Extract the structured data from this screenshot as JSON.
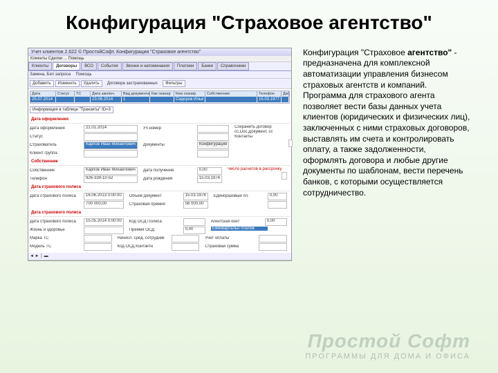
{
  "title": "Конфигурация \"Страховое агентство\"",
  "desc": {
    "a": "Конфигурация \"Страховое ",
    "b": "агентство\"",
    "c": " - предназначена для комплексной автоматизации управления бизнесом страховых агентств и компаний. Программа для страхового агента позволяет вести базы данных учета клиентов (юридических и физических лиц), заключенных с ними страховых договоров, выставлять им счета и контролировать оплату, а также задолженности, оформлять договора и любые другие документы по шаблонам, вести перечень банков, с которыми осуществляется сотрудничество."
  },
  "logo": {
    "t": "Простой Софт",
    "s": "ПРОГРАММЫ ДЛЯ ДОМА И ОФИСА"
  },
  "win": {
    "title": "Учет клиентов 2.622 © ПростойСофт. Конфигурация \"Страховое агентство\"",
    "menu": "Клиенты Сделки ... Помощь"
  },
  "tabs": [
    "Клиенты",
    "Договоры",
    "ВСО",
    "События",
    "Звонки и напоминания",
    "Платежи",
    "Банки",
    "Справочники"
  ],
  "tbar": {
    "b1": "Добавить",
    "b2": "Изменить",
    "b3": "Удалить",
    "mid": "Договора застрахованных",
    "f": "Фильтры"
  },
  "lvl2": {
    "l1": "Замена, Бял запроса",
    "l2": "Помощь"
  },
  "gridH": [
    "Дата",
    "Статус",
    "ТС",
    "Дата заключ.",
    "Вид документа",
    "Как сканер",
    "Кем сканир.",
    "Собственник",
    "Телефон",
    "Дата начала"
  ],
  "gridR": [
    "25.07.2014",
    "",
    "",
    "23.06.2014",
    "1",
    "",
    "Сидоров Илья Михайлович",
    "",
    "15.03.1977"
  ],
  "panel": "Информация в таблице \"Транзиты\" ID=3",
  "form": {
    "h1": "Дата оформления",
    "v1": "21.01.2014",
    "n1": "Уч номер",
    "h2": "Статус",
    "h3": "Страхователь",
    "v3": "Карпов Иван Михайлович",
    "n3": "Документы",
    "nv3": "Конфигурация",
    "h4": "Клиент группа",
    "h5": "Собственник",
    "h6": "Карпов Иван Михайлович",
    "h7": "Телефон",
    "v7": "926-339-10-52",
    "n7": "Дата рождения",
    "nv7": "15.03.1974",
    "h8": "Дата страхового полиса",
    "v8": "16.06.2013 0:00:00",
    "n8": "Дата получения",
    "nv8": "0,00",
    "r8": "Число расчетов в рассрочку",
    "v9": "700 000,00",
    "n9": "Объем документ",
    "nv9": "15.03.1974",
    "n10": "Страховая премия",
    "nv10": "56 000,00",
    "r10": "Единоразовый пл.",
    "rv10": "0,00",
    "ha": "Дата страхового полиса",
    "va": "15.05.2014 0:00:00",
    "na": "Код ОСД Полиса",
    "nva": "",
    "ra": "Агентская конт",
    "rva": "0,00",
    "hb": "Жизнь и здоровье",
    "nb": "Премия ОСД",
    "nvb": "0,00",
    "rc": "Ежеквартальн платеж",
    "hc": "Марка ТС",
    "nc": "Начисл. сред. сотрудник",
    "rd": "Учет оплаты",
    "hd": "Модель ТС",
    "vd": "",
    "nd": "Код ОСД Контактн",
    "re": "Страховая сумма"
  }
}
